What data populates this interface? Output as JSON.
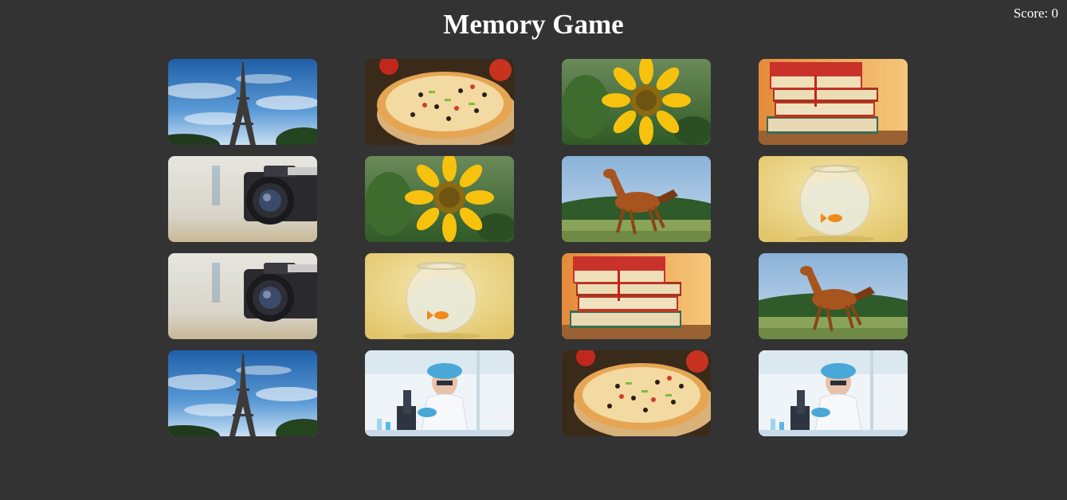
{
  "header": {
    "title": "Memory Game",
    "score_label": "Score: 0"
  },
  "board": {
    "rows": 4,
    "columns": 4,
    "cards": [
      {
        "row": 1,
        "col": 1,
        "image": "eiffel-tower",
        "face_up": true
      },
      {
        "row": 1,
        "col": 2,
        "image": "pizza",
        "face_up": true
      },
      {
        "row": 1,
        "col": 3,
        "image": "sunflower",
        "face_up": true
      },
      {
        "row": 1,
        "col": 4,
        "image": "books",
        "face_up": true
      },
      {
        "row": 2,
        "col": 1,
        "image": "camera",
        "face_up": true
      },
      {
        "row": 2,
        "col": 2,
        "image": "sunflower",
        "face_up": true
      },
      {
        "row": 2,
        "col": 3,
        "image": "horse",
        "face_up": true
      },
      {
        "row": 2,
        "col": 4,
        "image": "goldfish-bowl",
        "face_up": true
      },
      {
        "row": 3,
        "col": 1,
        "image": "camera",
        "face_up": true
      },
      {
        "row": 3,
        "col": 2,
        "image": "goldfish-bowl",
        "face_up": true
      },
      {
        "row": 3,
        "col": 3,
        "image": "books",
        "face_up": true
      },
      {
        "row": 3,
        "col": 4,
        "image": "horse",
        "face_up": true
      },
      {
        "row": 4,
        "col": 1,
        "image": "eiffel-tower",
        "face_up": true
      },
      {
        "row": 4,
        "col": 2,
        "image": "scientist-microscope",
        "face_up": true
      },
      {
        "row": 4,
        "col": 3,
        "image": "pizza",
        "face_up": true
      },
      {
        "row": 4,
        "col": 4,
        "image": "scientist-microscope",
        "face_up": true
      }
    ]
  },
  "colors": {
    "background": "#333333",
    "text": "#ffffff"
  }
}
